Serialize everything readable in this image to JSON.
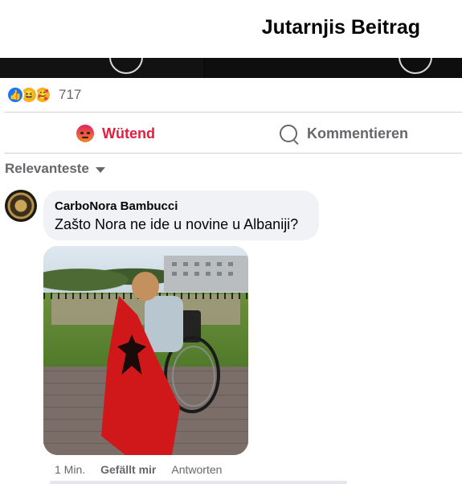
{
  "header": {
    "title": "Jutarnjis Beitrag"
  },
  "reactions": {
    "icons": [
      "like-icon",
      "haha-icon",
      "care-icon"
    ],
    "count": "717"
  },
  "actions": {
    "react": {
      "label": "Wütend",
      "icon": "angry-face-icon",
      "color": "#e41e3f"
    },
    "comment": {
      "label": "Kommentieren",
      "icon": "comment-icon"
    }
  },
  "sort": {
    "label": "Relevanteste"
  },
  "comment": {
    "author": "CarboNora Bambucci",
    "text": "Zašto Nora ne ide u novine u Albaniji?",
    "time": "1 Min.",
    "like_label": "Gefällt mir",
    "reply_label": "Antworten"
  },
  "colors": {
    "accent": "#1877f2",
    "angry": "#e41e3f",
    "muted": "#65676b",
    "bubble": "#f0f2f5"
  }
}
